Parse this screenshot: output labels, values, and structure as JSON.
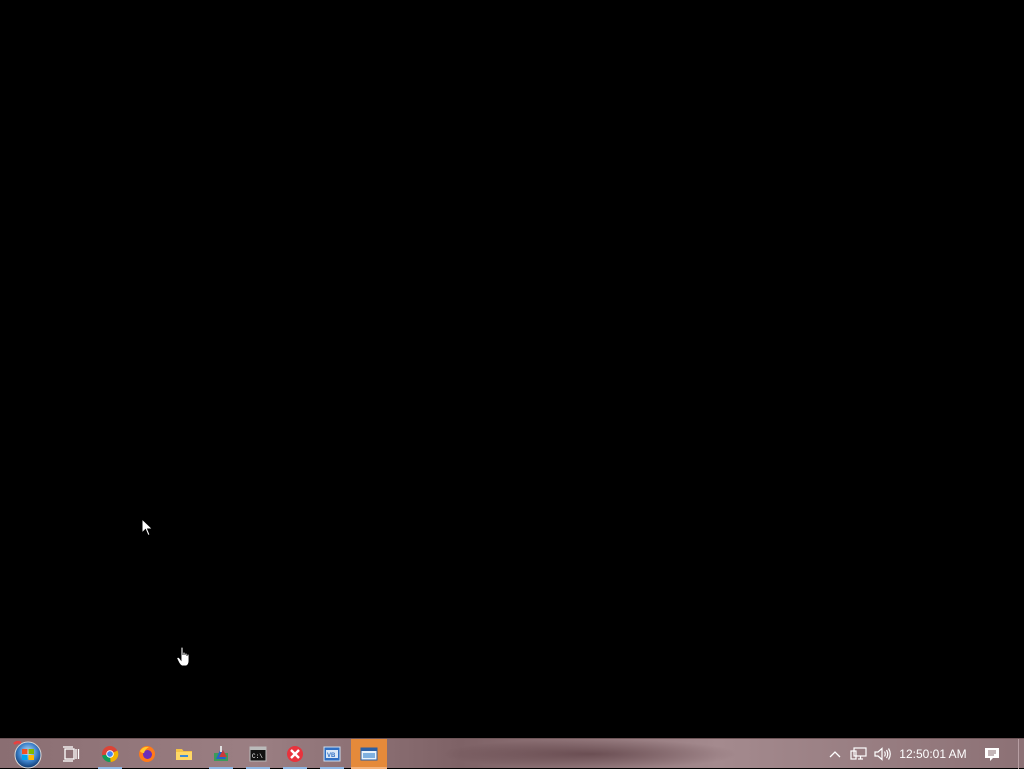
{
  "desktop": {
    "background_color": "#000000"
  },
  "taskbar": {
    "start_button": {
      "icon": "windows-orb-icon"
    },
    "pinned": [
      {
        "name": "task-view",
        "icon": "task-view-icon",
        "running": false,
        "active": false
      },
      {
        "name": "chrome",
        "icon": "chrome-icon",
        "running": true,
        "active": false
      },
      {
        "name": "firefox",
        "icon": "firefox-icon",
        "running": false,
        "active": false
      },
      {
        "name": "file-explorer",
        "icon": "folder-icon",
        "running": false,
        "active": false
      },
      {
        "name": "paint-app",
        "icon": "paint-icon",
        "running": true,
        "active": false
      },
      {
        "name": "command-prompt",
        "icon": "cmd-icon",
        "running": true,
        "active": false
      },
      {
        "name": "xmind",
        "icon": "xmind-icon",
        "running": true,
        "active": false
      },
      {
        "name": "vb-app",
        "icon": "vb-icon",
        "running": true,
        "active": false
      },
      {
        "name": "window-app",
        "icon": "window-app-icon",
        "running": true,
        "active": true
      }
    ],
    "tray": {
      "chevron_icon": "chevron-up-icon",
      "network_icon": "network-icon",
      "volume_icon": "volume-icon",
      "clock_text": "12:50:01 AM",
      "notification_icon": "action-center-icon"
    },
    "accent_color": "#e58a3a"
  }
}
